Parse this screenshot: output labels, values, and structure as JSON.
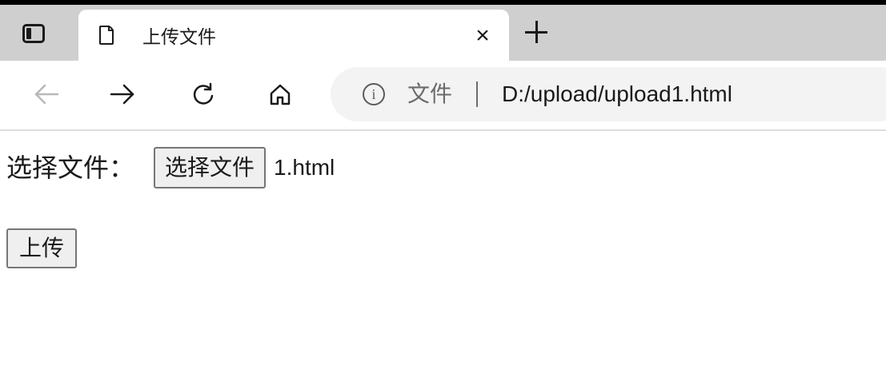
{
  "browser": {
    "tab": {
      "title": "上传文件",
      "close_glyph": "×"
    },
    "address": {
      "scheme_label": "文件",
      "url": "D:/upload/upload1.html"
    },
    "icons": {
      "tab_actions": "tab-actions-icon",
      "page": "page-icon",
      "close": "close-icon",
      "new_tab": "plus-icon",
      "back": "back-arrow-icon",
      "forward": "forward-arrow-icon",
      "refresh": "refresh-icon",
      "home": "home-icon",
      "info": "info-icon"
    }
  },
  "page": {
    "file_label": "选择文件：",
    "choose_button_label": "选择文件",
    "chosen_file_name": "1.html",
    "upload_button_label": "上传"
  },
  "colors": {
    "tabstrip_bg": "#cfcfcf",
    "addressbar_bg": "#f3f3f3",
    "button_bg": "#efefef",
    "button_border": "#767676"
  }
}
